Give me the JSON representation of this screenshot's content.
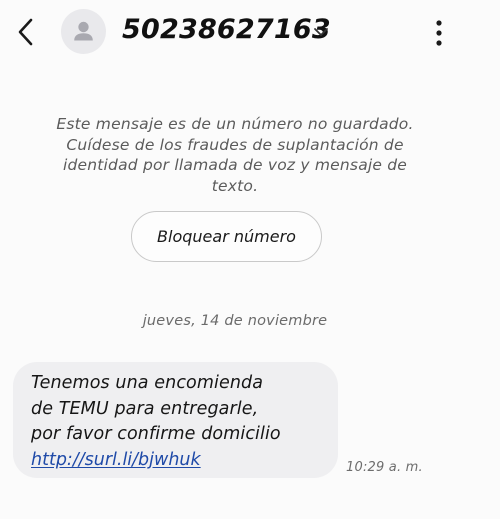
{
  "header": {
    "back_icon": "chevron-left-icon",
    "avatar_icon": "person-icon",
    "contact_number": "50238627163",
    "expand_icon": "chevron-down-icon",
    "more_icon": "more-vertical-icon"
  },
  "notice": {
    "line1": "Este mensaje es de un número no guardado.",
    "line2": "Cuídese de los fraudes de suplantación de",
    "line3": "identidad por llamada de voz y mensaje de",
    "line4": "texto.",
    "block_button_label": "Bloquear número"
  },
  "conversation": {
    "date_separator": "jueves, 14 de noviembre",
    "messages": [
      {
        "lines": [
          "Tenemos una encomienda",
          "de TEMU para entregarle,",
          "por favor confirme domicilio"
        ],
        "link": "http://surl.li/bjwhuk",
        "time": "10:29 a. m."
      }
    ]
  },
  "colors": {
    "background": "#fbfbfb",
    "bubble": "#efeff1",
    "link": "#1f4aa8",
    "avatar_bg": "#e9e9ec",
    "avatar_fg": "#a9a9b0",
    "muted_text": "#5b5b5b"
  }
}
